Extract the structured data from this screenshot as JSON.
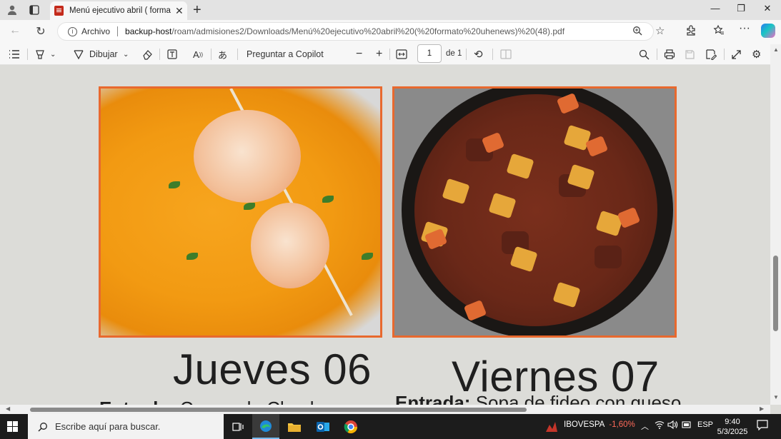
{
  "browser": {
    "tab_title": "Menú ejecutivo abril ( formato uh",
    "address_scheme_label": "Archivo",
    "url_host": "backup-host",
    "url_path": "/roam/admisiones2/Downloads/Menú%20ejecutivo%20abril%20(%20formato%20uhenews)%20(48).pdf"
  },
  "pdf_toolbar": {
    "draw_label": "Dibujar",
    "copilot_label": "Preguntar a Copilot",
    "page_current": "1",
    "page_of": "de 1"
  },
  "document": {
    "left_day": "Jueves 06",
    "right_day": "Viernes 07",
    "left_entrada_label": "Entrada:",
    "left_entrada_text": "Crema de Choclo",
    "right_entrada_label": "Entrada:",
    "right_entrada_text": "Sopa de fideo con queso"
  },
  "taskbar": {
    "search_placeholder": "Escribe aquí para buscar.",
    "ticker_name": "IBOVESPA",
    "ticker_change": "-1,60%",
    "language": "ESP",
    "time": "9:40",
    "date": "5/3/2025"
  },
  "colors": {
    "photo_border": "#e8692e",
    "ticker_negative": "#ff6a5a"
  }
}
